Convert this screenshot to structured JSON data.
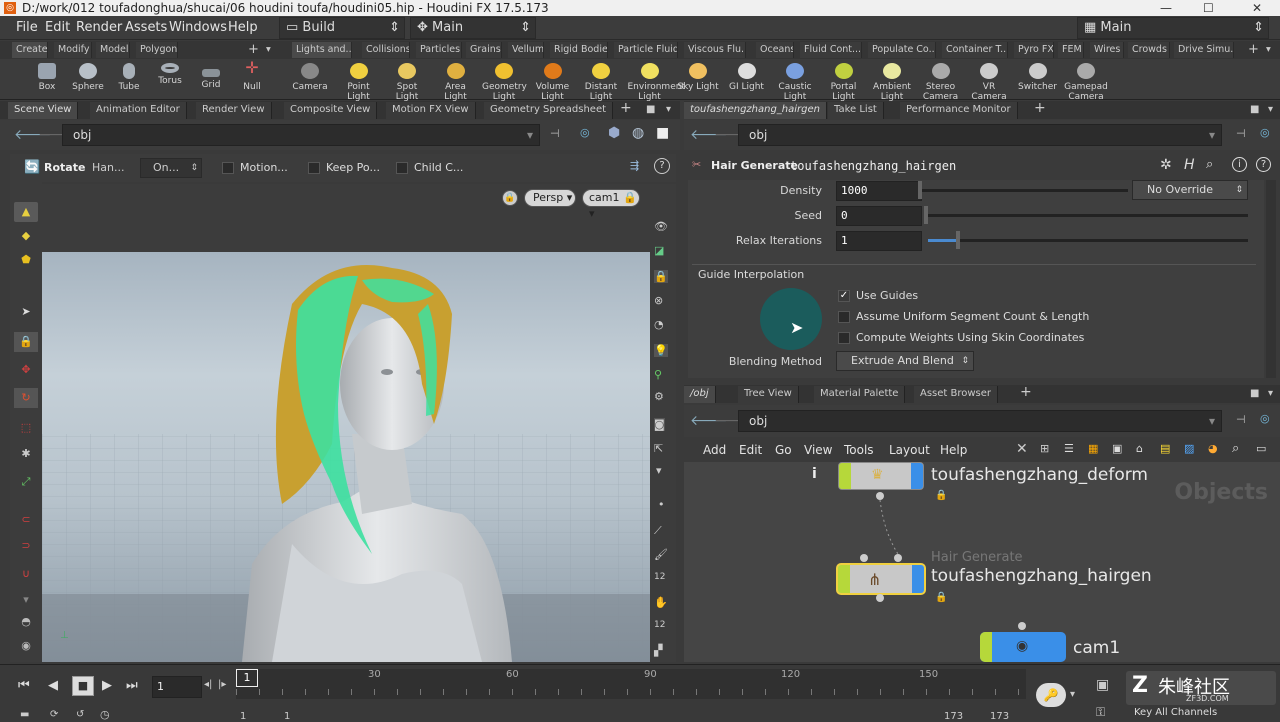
{
  "window": {
    "title": "D:/work/012 toufadonghua/shucai/06 houdini toufa/houdini05.hip - Houdini FX 17.5.173",
    "controls": [
      "—",
      "☐",
      "✕"
    ]
  },
  "menubar": {
    "items": [
      "File",
      "Edit",
      "Render",
      "Assets",
      "Windows",
      "Help"
    ],
    "desktop": "Build",
    "context": "Main",
    "right_context": "Main"
  },
  "shelf_tabs_left": [
    "Create",
    "Modify",
    "Model",
    "Polygon"
  ],
  "shelf_tabs_right": [
    "Lights and...",
    "Collisions",
    "Particles",
    "Grains",
    "Vellum",
    "Rigid Bodies",
    "Particle Fluids",
    "Viscous Flu...",
    "Oceans",
    "Fluid Cont...",
    "Populate Co...",
    "Container T...",
    "Pyro FX",
    "FEM",
    "Wires",
    "Crowds",
    "Drive Simu..."
  ],
  "shelf_tools_left": [
    {
      "label": "Box",
      "icon": "box-icon"
    },
    {
      "label": "Sphere",
      "icon": "sphere-icon"
    },
    {
      "label": "Tube",
      "icon": "tube-icon"
    },
    {
      "label": "Torus",
      "icon": "torus-icon"
    },
    {
      "label": "Grid",
      "icon": "grid-icon"
    },
    {
      "label": "Null",
      "icon": "null-icon"
    }
  ],
  "shelf_tools_right": [
    {
      "label": "Camera",
      "icon": "camera-icon"
    },
    {
      "label": "Point Light",
      "icon": "point-light-icon"
    },
    {
      "label": "Spot Light",
      "icon": "spot-light-icon"
    },
    {
      "label": "Area Light",
      "icon": "area-light-icon"
    },
    {
      "label": "Geometry Light",
      "icon": "geometry-light-icon"
    },
    {
      "label": "Volume Light",
      "icon": "volume-light-icon"
    },
    {
      "label": "Distant Light",
      "icon": "distant-light-icon"
    },
    {
      "label": "Environment Light",
      "icon": "environment-light-icon"
    },
    {
      "label": "Sky Light",
      "icon": "sky-light-icon"
    },
    {
      "label": "GI Light",
      "icon": "gi-light-icon"
    },
    {
      "label": "Caustic Light",
      "icon": "caustic-light-icon"
    },
    {
      "label": "Portal Light",
      "icon": "portal-light-icon"
    },
    {
      "label": "Ambient Light",
      "icon": "ambient-light-icon"
    },
    {
      "label": "Stereo Camera",
      "icon": "stereo-camera-icon"
    },
    {
      "label": "VR Camera",
      "icon": "vr-camera-icon"
    },
    {
      "label": "Switcher",
      "icon": "switcher-icon"
    },
    {
      "label": "Gamepad Camera",
      "icon": "gamepad-camera-icon"
    }
  ],
  "left_pane": {
    "tabs": [
      "Scene View",
      "Animation Editor",
      "Render View",
      "Composite View",
      "Motion FX View",
      "Geometry Spreadsheet"
    ],
    "path": "obj",
    "operator": {
      "name": "Rotate",
      "handle": "Han...",
      "mode": "On...",
      "opts": [
        "Motion...",
        "Keep Po...",
        "Child C..."
      ]
    },
    "viewport": {
      "persp": "Persp",
      "camera": "cam1"
    }
  },
  "right_pane": {
    "tabs": [
      "toufashengzhang_hairgen",
      "Take List",
      "Performance Monitor"
    ],
    "path": "obj",
    "node_type": "Hair Generate",
    "node_name": "toufashengzhang_hairgen",
    "params": {
      "density_label": "Density",
      "density": "1000",
      "override": "No Override",
      "seed_label": "Seed",
      "seed": "0",
      "relax_label": "Relax Iterations",
      "relax": "1",
      "section": "Guide Interpolation",
      "use_guides": "Use Guides",
      "assume_uniform": "Assume Uniform Segment Count & Length",
      "compute_weights": "Compute Weights Using Skin Coordinates",
      "blending_label": "Blending Method",
      "blending": "Extrude And Blend"
    }
  },
  "network_pane": {
    "tabs": [
      "/obj",
      "Tree View",
      "Material Palette",
      "Asset Browser"
    ],
    "path": "obj",
    "menu": [
      "Add",
      "Edit",
      "Go",
      "View",
      "Tools",
      "Layout",
      "Help"
    ],
    "watermark": "Objects",
    "nodes": {
      "deform": "toufashengzhang_deform",
      "hairgen_type": "Hair Generate",
      "hairgen": "toufashengzhang_hairgen",
      "cam": "cam1"
    }
  },
  "timeline": {
    "frame": "1",
    "cursor": "1",
    "ticks": [
      "30",
      "60",
      "90",
      "120",
      "150"
    ],
    "start": "1",
    "start2": "1",
    "end": "173",
    "end2": "173",
    "key_all": "Key All Channels",
    "watermark": "朱峰社区",
    "watermark_sub": "ZF3D.COM"
  },
  "colors": {
    "accent": "#e07a1a",
    "hair_green": "#3de0a0",
    "hair_gold": "#c8a030",
    "node_green": "#b6d83a",
    "node_blue": "#3a8fe8"
  }
}
